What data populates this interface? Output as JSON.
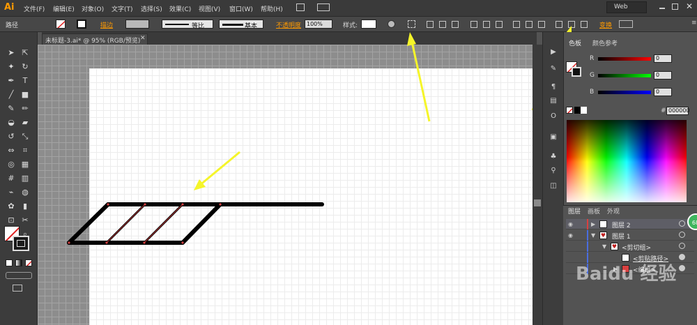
{
  "app": {
    "logo": "Ai",
    "workspace": "Web"
  },
  "menu": [
    "文件(F)",
    "编辑(E)",
    "对象(O)",
    "文字(T)",
    "选择(S)",
    "效果(C)",
    "视图(V)",
    "窗口(W)",
    "帮助(H)"
  ],
  "control_bar": {
    "selection_label": "路径",
    "stroke_link": "描边",
    "profile_label": "等比",
    "brush_label": "基本",
    "opacity_link": "不透明度",
    "opacity_value": "100%",
    "style_label": "样式:",
    "transform_link": "变换"
  },
  "document": {
    "tab_title": "未标题-3.ai* @ 95% (RGB/预览)"
  },
  "color_panel": {
    "tabs": [
      "色板",
      "颜色参考"
    ],
    "channels": [
      {
        "label": "R",
        "value": "0"
      },
      {
        "label": "G",
        "value": "0"
      },
      {
        "label": "B",
        "value": "0"
      }
    ],
    "hex_symbol": "#",
    "hex_value": "000000"
  },
  "layers_panel": {
    "tabs": [
      "图层",
      "画板",
      "外观"
    ],
    "rows": [
      {
        "name": "图层 2"
      },
      {
        "name": "图层 1"
      },
      {
        "name": "<剪切组>"
      },
      {
        "name": "<剪贴路径>"
      },
      {
        "name": "<编组>"
      }
    ]
  },
  "badge": "68",
  "watermark": "Baidu 经验",
  "colors": {
    "accent_orange": "#ff9a00",
    "annotation_arrow": "#f5f52a",
    "stroke": "#000000",
    "anchor_red": "#b03030"
  }
}
